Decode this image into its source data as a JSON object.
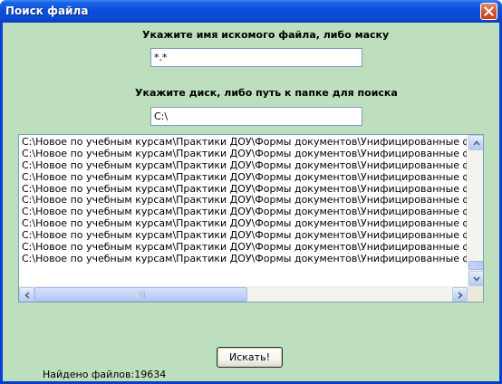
{
  "window": {
    "title": "Поиск файла"
  },
  "form": {
    "mask_label": "Укажите имя искомого файла, либо маску",
    "mask_value": "*.*",
    "path_label": "Укажите диск, либо путь к папке для поиска",
    "path_value": "C:\\"
  },
  "results": {
    "items": [
      "C:\\Новое по учебным курсам\\Практики ДОУ\\Формы документов\\Унифицированные формы до",
      "C:\\Новое по учебным курсам\\Практики ДОУ\\Формы документов\\Унифицированные формы до",
      "C:\\Новое по учебным курсам\\Практики ДОУ\\Формы документов\\Унифицированные формы до",
      "C:\\Новое по учебным курсам\\Практики ДОУ\\Формы документов\\Унифицированные формы до",
      "C:\\Новое по учебным курсам\\Практики ДОУ\\Формы документов\\Унифицированные формы до",
      "C:\\Новое по учебным курсам\\Практики ДОУ\\Формы документов\\Унифицированные формы до",
      "C:\\Новое по учебным курсам\\Практики ДОУ\\Формы документов\\Унифицированные формы до",
      "C:\\Новое по учебным курсам\\Практики ДОУ\\Формы документов\\Унифицированные формы до",
      "C:\\Новое по учебным курсам\\Практики ДОУ\\Формы документов\\Унифицированные формы до",
      "C:\\Новое по учебным курсам\\Практики ДОУ\\Формы документов\\Унифицированные формы до",
      "C:\\Новое по учебным курсам\\Практики ДОУ\\Формы документов\\Унифицированные формы до"
    ],
    "vertical_scroll_position": 0.95,
    "horizontal_scroll_position": 0.0
  },
  "actions": {
    "search_label": "Искать!"
  },
  "status": {
    "found_text": "Найдено файлов:19634"
  },
  "colors": {
    "client_background": "#bddfbd",
    "titlebar": "#0a4fd9",
    "close_button": "#d9582f"
  }
}
